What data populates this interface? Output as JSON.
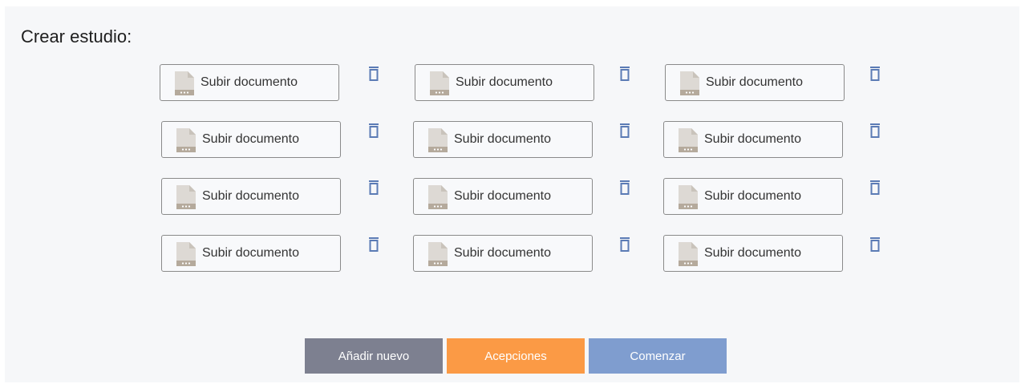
{
  "page": {
    "title": "Crear estudio:"
  },
  "uploads": {
    "label": "Subir documento",
    "icon": "document-file-icon",
    "delete_icon": "trash-icon",
    "rows": 4,
    "columns": 3
  },
  "actions": {
    "add_label": "Añadir nuevo",
    "meanings_label": "Acepciones",
    "start_label": "Comenzar"
  },
  "colors": {
    "panel_background": "#f6f7f9",
    "add_button": "#7d8090",
    "meanings_button": "#fb9a45",
    "start_button": "#7f9dcf",
    "trash_icon": "#5b7bb5"
  }
}
